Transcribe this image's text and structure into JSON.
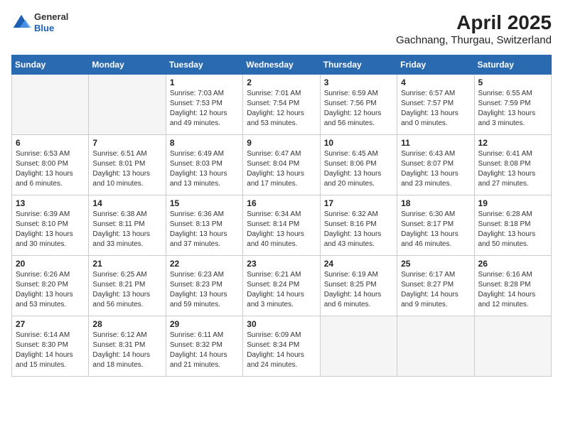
{
  "header": {
    "logo": {
      "general": "General",
      "blue": "Blue"
    },
    "month_title": "April 2025",
    "location": "Gachnang, Thurgau, Switzerland"
  },
  "weekdays": [
    "Sunday",
    "Monday",
    "Tuesday",
    "Wednesday",
    "Thursday",
    "Friday",
    "Saturday"
  ],
  "weeks": [
    [
      {
        "day": "",
        "info": ""
      },
      {
        "day": "",
        "info": ""
      },
      {
        "day": "1",
        "info": "Sunrise: 7:03 AM\nSunset: 7:53 PM\nDaylight: 12 hours\nand 49 minutes."
      },
      {
        "day": "2",
        "info": "Sunrise: 7:01 AM\nSunset: 7:54 PM\nDaylight: 12 hours\nand 53 minutes."
      },
      {
        "day": "3",
        "info": "Sunrise: 6:59 AM\nSunset: 7:56 PM\nDaylight: 12 hours\nand 56 minutes."
      },
      {
        "day": "4",
        "info": "Sunrise: 6:57 AM\nSunset: 7:57 PM\nDaylight: 13 hours\nand 0 minutes."
      },
      {
        "day": "5",
        "info": "Sunrise: 6:55 AM\nSunset: 7:59 PM\nDaylight: 13 hours\nand 3 minutes."
      }
    ],
    [
      {
        "day": "6",
        "info": "Sunrise: 6:53 AM\nSunset: 8:00 PM\nDaylight: 13 hours\nand 6 minutes."
      },
      {
        "day": "7",
        "info": "Sunrise: 6:51 AM\nSunset: 8:01 PM\nDaylight: 13 hours\nand 10 minutes."
      },
      {
        "day": "8",
        "info": "Sunrise: 6:49 AM\nSunset: 8:03 PM\nDaylight: 13 hours\nand 13 minutes."
      },
      {
        "day": "9",
        "info": "Sunrise: 6:47 AM\nSunset: 8:04 PM\nDaylight: 13 hours\nand 17 minutes."
      },
      {
        "day": "10",
        "info": "Sunrise: 6:45 AM\nSunset: 8:06 PM\nDaylight: 13 hours\nand 20 minutes."
      },
      {
        "day": "11",
        "info": "Sunrise: 6:43 AM\nSunset: 8:07 PM\nDaylight: 13 hours\nand 23 minutes."
      },
      {
        "day": "12",
        "info": "Sunrise: 6:41 AM\nSunset: 8:08 PM\nDaylight: 13 hours\nand 27 minutes."
      }
    ],
    [
      {
        "day": "13",
        "info": "Sunrise: 6:39 AM\nSunset: 8:10 PM\nDaylight: 13 hours\nand 30 minutes."
      },
      {
        "day": "14",
        "info": "Sunrise: 6:38 AM\nSunset: 8:11 PM\nDaylight: 13 hours\nand 33 minutes."
      },
      {
        "day": "15",
        "info": "Sunrise: 6:36 AM\nSunset: 8:13 PM\nDaylight: 13 hours\nand 37 minutes."
      },
      {
        "day": "16",
        "info": "Sunrise: 6:34 AM\nSunset: 8:14 PM\nDaylight: 13 hours\nand 40 minutes."
      },
      {
        "day": "17",
        "info": "Sunrise: 6:32 AM\nSunset: 8:16 PM\nDaylight: 13 hours\nand 43 minutes."
      },
      {
        "day": "18",
        "info": "Sunrise: 6:30 AM\nSunset: 8:17 PM\nDaylight: 13 hours\nand 46 minutes."
      },
      {
        "day": "19",
        "info": "Sunrise: 6:28 AM\nSunset: 8:18 PM\nDaylight: 13 hours\nand 50 minutes."
      }
    ],
    [
      {
        "day": "20",
        "info": "Sunrise: 6:26 AM\nSunset: 8:20 PM\nDaylight: 13 hours\nand 53 minutes."
      },
      {
        "day": "21",
        "info": "Sunrise: 6:25 AM\nSunset: 8:21 PM\nDaylight: 13 hours\nand 56 minutes."
      },
      {
        "day": "22",
        "info": "Sunrise: 6:23 AM\nSunset: 8:23 PM\nDaylight: 13 hours\nand 59 minutes."
      },
      {
        "day": "23",
        "info": "Sunrise: 6:21 AM\nSunset: 8:24 PM\nDaylight: 14 hours\nand 3 minutes."
      },
      {
        "day": "24",
        "info": "Sunrise: 6:19 AM\nSunset: 8:25 PM\nDaylight: 14 hours\nand 6 minutes."
      },
      {
        "day": "25",
        "info": "Sunrise: 6:17 AM\nSunset: 8:27 PM\nDaylight: 14 hours\nand 9 minutes."
      },
      {
        "day": "26",
        "info": "Sunrise: 6:16 AM\nSunset: 8:28 PM\nDaylight: 14 hours\nand 12 minutes."
      }
    ],
    [
      {
        "day": "27",
        "info": "Sunrise: 6:14 AM\nSunset: 8:30 PM\nDaylight: 14 hours\nand 15 minutes."
      },
      {
        "day": "28",
        "info": "Sunrise: 6:12 AM\nSunset: 8:31 PM\nDaylight: 14 hours\nand 18 minutes."
      },
      {
        "day": "29",
        "info": "Sunrise: 6:11 AM\nSunset: 8:32 PM\nDaylight: 14 hours\nand 21 minutes."
      },
      {
        "day": "30",
        "info": "Sunrise: 6:09 AM\nSunset: 8:34 PM\nDaylight: 14 hours\nand 24 minutes."
      },
      {
        "day": "",
        "info": ""
      },
      {
        "day": "",
        "info": ""
      },
      {
        "day": "",
        "info": ""
      }
    ]
  ]
}
